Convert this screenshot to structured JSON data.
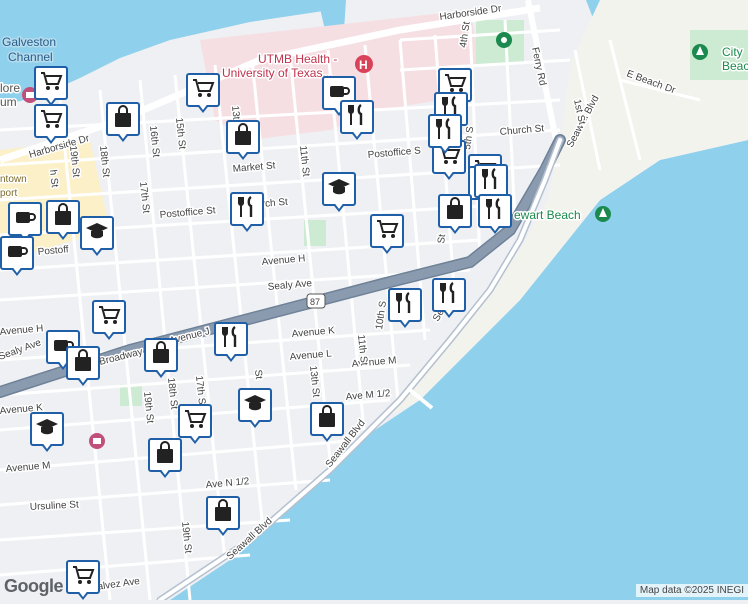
{
  "map": {
    "colors": {
      "water": "#8fd0ec",
      "land": "#eef0f3",
      "road": "#ffffff",
      "highway": "#8a9bb0",
      "highway_edge": "#6e8197",
      "hospital_zone": "#f6dfe3",
      "park": "#cdebd2",
      "downtown": "#fbf0c8",
      "marker_border": "#1f5fa8"
    },
    "labels": {
      "water_galveston": "Galveston",
      "water_channel": "Channel",
      "poi_utmb_line1": "UTMB Health -",
      "poi_utmb_line2": "University of Texas...",
      "poi_city_line1": "City",
      "poi_city_line2": "Beac",
      "poi_stewart": "ewart Beach",
      "poi_museum_line1": "lore",
      "poi_museum_line2": "um",
      "district_line1": "ntown",
      "district_line2": "port",
      "shield_87": "87"
    },
    "streets": {
      "harborside_dr": "Harborside Dr",
      "harborside_dr_left": "Harborside Dr",
      "church_st": "Church St",
      "church_st_mid": "rch St",
      "postoffice_st": "Postoffice St",
      "postoffice_st_right": "Postoffice S",
      "postoffice_st_left": "Postoff",
      "market_st": "Market St",
      "avenue_h": "Avenue H",
      "avenue_h_left": "Avenue H",
      "sealy_ave": "Sealy Ave",
      "sealy_ave_left": "Sealy Ave",
      "broadway": "Broadway",
      "avenue_j": "Avenue J",
      "avenue_k": "Avenue K",
      "avenue_k_left": "Avenue K",
      "avenue_l": "Avenue L",
      "avenue_m": "Avenue M",
      "avenue_m_left": "Avenue M",
      "ave_m_half": "Ave M 1/2",
      "ave_n_half": "Ave N 1/2",
      "ursuline_st": "Ursuline St",
      "de_galvez_ave": "e Galvez Ave",
      "seawall_blvd_1": "Seawall Blvd",
      "seawall_blvd_2": "Seawall Blvd",
      "seawall_blvd_3": "Seawall Blvd",
      "seawall_blvd_4": "Sea",
      "ferry_rd": "Ferry Rd",
      "e_beach_dr": "E Beach Dr",
      "st_4th": "4th St",
      "st_1st": "1st St",
      "st_5th": "5th S",
      "st_9th": "St",
      "st_10th": "10th S",
      "st_11th": "11th St",
      "st_11th_b": "11th St",
      "st_12th": "St",
      "st_13th": "13th",
      "st_13th_b": "13th St",
      "st_15th": "15th St",
      "st_16th": "16th St",
      "st_17th": "17th St",
      "st_17th_b": "17th S",
      "st_18th": "18th St",
      "st_18th_b": "18th St",
      "st_19th": "19th St",
      "st_19th_b": "19th St",
      "st_19th_c": "19th St",
      "st_20th": "h St"
    },
    "markers": [
      {
        "icon": "cart-icon",
        "type": "grocery"
      },
      {
        "icon": "cart-icon",
        "type": "grocery"
      },
      {
        "icon": "cart-icon",
        "type": "grocery"
      },
      {
        "icon": "bag-icon",
        "type": "shopping"
      },
      {
        "icon": "cart-icon",
        "type": "grocery"
      },
      {
        "icon": "coffee-icon",
        "type": "cafe"
      },
      {
        "icon": "restaurant-icon",
        "type": "restaurant"
      },
      {
        "icon": "bag-icon",
        "type": "shopping"
      },
      {
        "icon": "cart-icon",
        "type": "grocery"
      },
      {
        "icon": "restaurant-icon",
        "type": "restaurant"
      },
      {
        "icon": "restaurant-icon",
        "type": "restaurant"
      },
      {
        "icon": "cart-icon",
        "type": "grocery"
      },
      {
        "icon": "restaurant-icon",
        "type": "restaurant"
      },
      {
        "icon": "restaurant-icon",
        "type": "restaurant"
      },
      {
        "icon": "school-icon",
        "type": "school"
      },
      {
        "icon": "restaurant-icon",
        "type": "restaurant"
      },
      {
        "icon": "cart-icon",
        "type": "grocery"
      },
      {
        "icon": "bag-icon",
        "type": "shopping"
      },
      {
        "icon": "restaurant-icon",
        "type": "restaurant"
      },
      {
        "icon": "coffee-icon",
        "type": "cafe"
      },
      {
        "icon": "bag-icon",
        "type": "shopping"
      },
      {
        "icon": "school-icon",
        "type": "school"
      },
      {
        "icon": "coffee-icon",
        "type": "cafe"
      },
      {
        "icon": "cart-icon",
        "type": "grocery"
      },
      {
        "icon": "restaurant-icon",
        "type": "restaurant"
      },
      {
        "icon": "restaurant-icon",
        "type": "restaurant"
      },
      {
        "icon": "coffee-icon",
        "type": "cafe"
      },
      {
        "icon": "bag-icon",
        "type": "shopping"
      },
      {
        "icon": "restaurant-icon",
        "type": "restaurant"
      },
      {
        "icon": "bag-icon",
        "type": "shopping"
      },
      {
        "icon": "school-icon",
        "type": "school"
      },
      {
        "icon": "school-icon",
        "type": "school"
      },
      {
        "icon": "cart-icon",
        "type": "grocery"
      },
      {
        "icon": "bag-icon",
        "type": "shopping"
      },
      {
        "icon": "bag-icon",
        "type": "shopping"
      },
      {
        "icon": "bag-icon",
        "type": "shopping"
      },
      {
        "icon": "cart-icon",
        "type": "grocery"
      }
    ],
    "footer": {
      "logo": "Google",
      "attribution": "Map data ©2025 INEGI"
    }
  }
}
